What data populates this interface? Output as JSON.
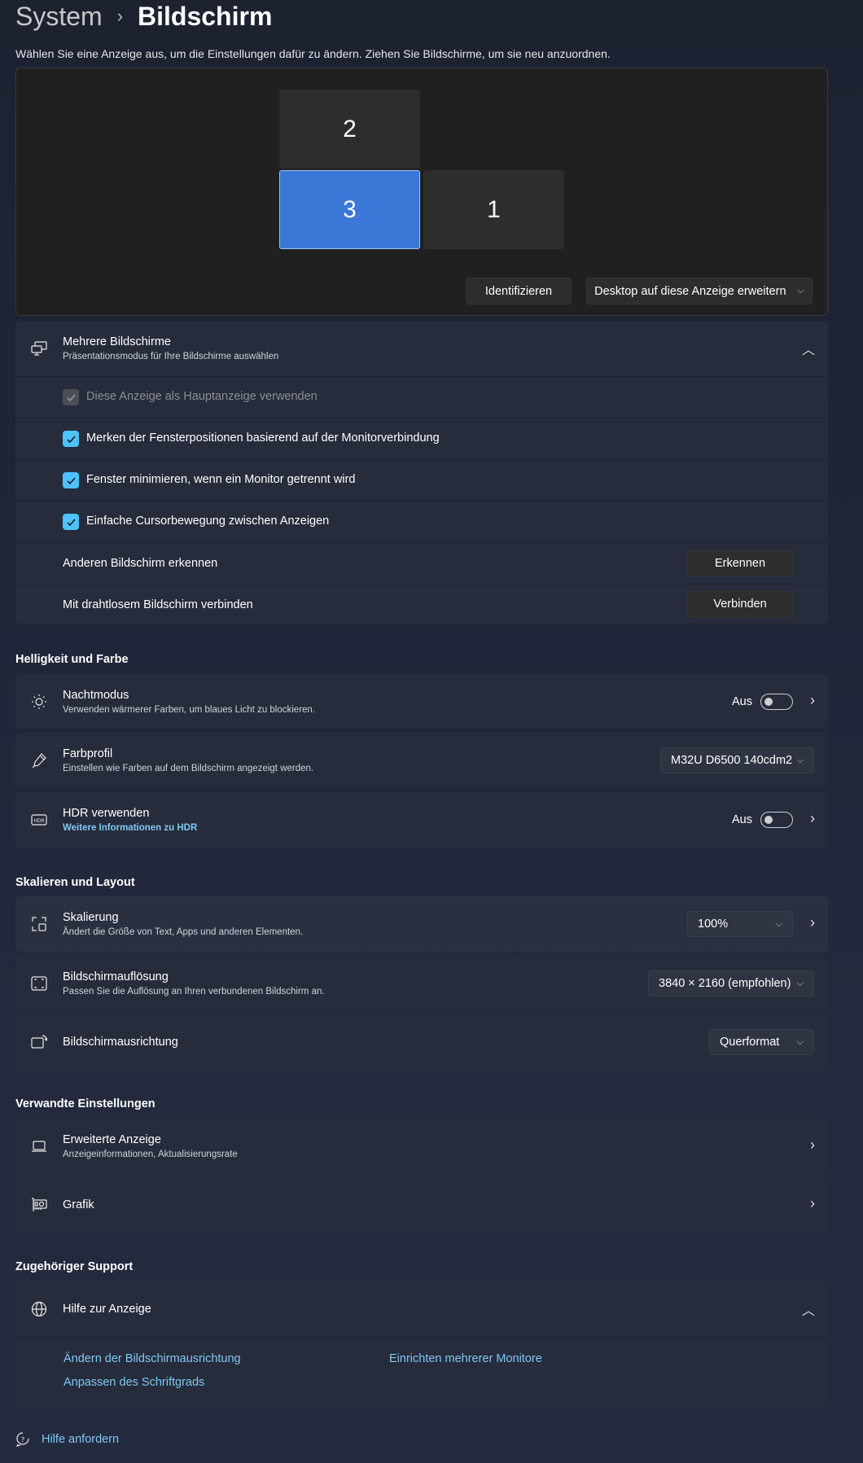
{
  "breadcrumb": {
    "root": "System",
    "separator": "›",
    "current": "Bildschirm"
  },
  "description": "Wählen Sie eine Anzeige aus, um die Einstellungen dafür zu ändern. Ziehen Sie Bildschirme, um sie neu anzuordnen.",
  "arrangement": {
    "monitors": [
      {
        "label": "2",
        "selected": false
      },
      {
        "label": "3",
        "selected": true
      },
      {
        "label": "1",
        "selected": false
      }
    ],
    "identify_label": "Identifizieren",
    "extend_label": "Desktop auf diese Anzeige erweitern"
  },
  "multiple": {
    "title": "Mehrere Bildschirme",
    "subtitle": "Präsentationsmodus für Ihre Bildschirme auswählen",
    "checks": [
      {
        "label": "Diese Anzeige als Hauptanzeige verwenden",
        "checked": true,
        "disabled": true
      },
      {
        "label": "Merken der Fensterpositionen basierend auf der Monitorverbindung",
        "checked": true,
        "disabled": false
      },
      {
        "label": "Fenster minimieren, wenn ein Monitor getrennt wird",
        "checked": true,
        "disabled": false
      },
      {
        "label": "Einfache Cursorbewegung zwischen Anzeigen",
        "checked": true,
        "disabled": false
      }
    ],
    "detect": {
      "label": "Anderen Bildschirm erkennen",
      "button": "Erkennen"
    },
    "wireless": {
      "label": "Mit drahtlosem Bildschirm verbinden",
      "button": "Verbinden"
    }
  },
  "brightness": {
    "heading": "Helligkeit und Farbe",
    "night": {
      "title": "Nachtmodus",
      "subtitle": "Verwenden wärmerer Farben, um blaues Licht zu blockieren.",
      "state": "Aus"
    },
    "profile": {
      "title": "Farbprofil",
      "subtitle": "Einstellen wie Farben auf dem Bildschirm angezeigt werden.",
      "value": "M32U D6500 140cdm2"
    },
    "hdr": {
      "title": "HDR verwenden",
      "link": "Weitere Informationen zu HDR",
      "state": "Aus"
    }
  },
  "scale": {
    "heading": "Skalieren und Layout",
    "scaling": {
      "title": "Skalierung",
      "subtitle": "Ändert die Größe von Text, Apps und anderen Elementen.",
      "value": "100%"
    },
    "resolution": {
      "title": "Bildschirmauflösung",
      "subtitle": "Passen Sie die Auflösung an Ihren verbundenen Bildschirm an.",
      "value": "3840 × 2160 (empfohlen)"
    },
    "orientation": {
      "title": "Bildschirmausrichtung",
      "value": "Querformat"
    }
  },
  "related": {
    "heading": "Verwandte Einstellungen",
    "advanced": {
      "title": "Erweiterte Anzeige",
      "subtitle": "Anzeigeinformationen, Aktualisierungsrate"
    },
    "graphics": {
      "title": "Grafik"
    }
  },
  "support": {
    "heading": "Zugehöriger Support",
    "help_title": "Hilfe zur Anzeige",
    "links": [
      "Ändern der Bildschirmausrichtung",
      "Einrichten mehrerer Monitore",
      "Anpassen des Schriftgrads"
    ]
  },
  "footer": {
    "get_help": "Hilfe anfordern"
  },
  "colors": {
    "accent": "#4cc2ff",
    "selected_monitor": "#3a77d6",
    "card": "#262c3b"
  }
}
